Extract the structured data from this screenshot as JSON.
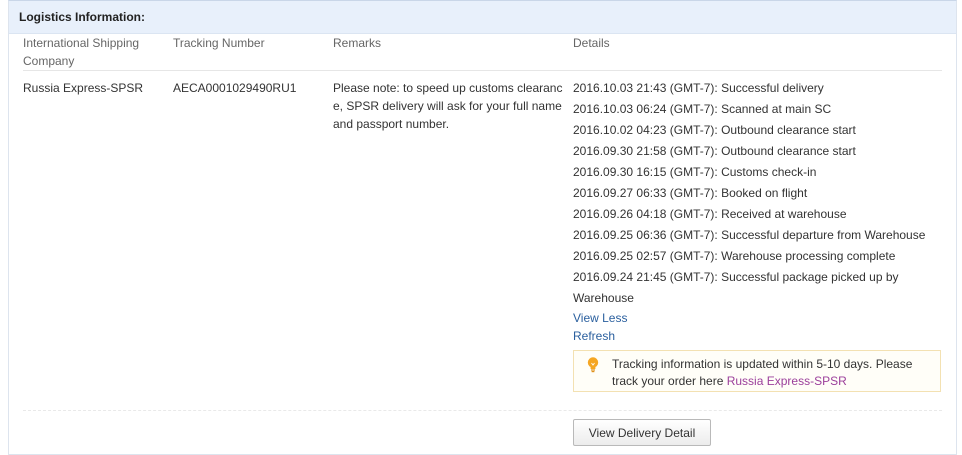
{
  "header": {
    "title": "Logistics Information:"
  },
  "columns": {
    "company": "International Shipping Company",
    "tracking": "Tracking Number",
    "remarks": "Remarks",
    "details": "Details"
  },
  "row": {
    "company": "Russia Express-SPSR",
    "tracking_number": "AECA0001029490RU1",
    "remarks": "Please note: to speed up customs clearance, SPSR delivery will ask for your full name and passport number."
  },
  "details": [
    "2016.10.03 21:43 (GMT-7): Successful delivery",
    "2016.10.03 06:24 (GMT-7): Scanned at main SC",
    "2016.10.02 04:23 (GMT-7): Outbound clearance start",
    "2016.09.30 21:58 (GMT-7): Outbound clearance start",
    "2016.09.30 16:15 (GMT-7): Customs check-in",
    "2016.09.27 06:33 (GMT-7): Booked on flight",
    "2016.09.26 04:18 (GMT-7): Received at warehouse",
    "2016.09.25 06:36 (GMT-7): Successful departure from Warehouse",
    "2016.09.25 02:57 (GMT-7): Warehouse processing complete",
    "2016.09.24 21:45 (GMT-7): Successful package picked up by Warehouse"
  ],
  "links": {
    "view_less": "View Less",
    "refresh": "Refresh"
  },
  "notice": {
    "text": "Tracking information is updated within 5-10 days. Please track your order here ",
    "link": "Russia Express-SPSR",
    "icon": "lightbulb-icon"
  },
  "buttons": {
    "view_delivery_detail": "View Delivery Detail"
  },
  "colors": {
    "header_bg": "#e8f0fb",
    "link": "#2a5f9e",
    "notice_link": "#9b3f9b",
    "bulb": "#f5a623"
  }
}
